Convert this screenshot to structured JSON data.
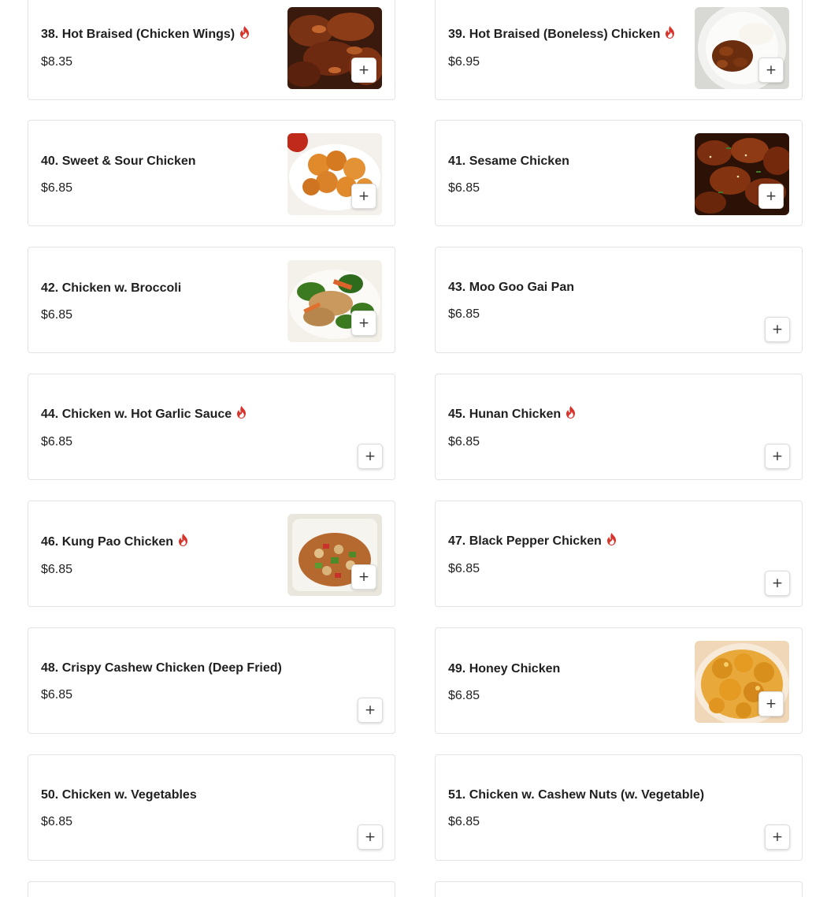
{
  "menu": {
    "items": [
      {
        "label": "38. Hot Braised (Chicken Wings)",
        "price": "$8.35",
        "spicy": true,
        "image": "chicken-wings-photo",
        "add_label": "+"
      },
      {
        "label": "39. Hot Braised (Boneless) Chicken",
        "price": "$6.95",
        "spicy": true,
        "image": "boneless-chicken-rice-photo",
        "add_label": "+"
      },
      {
        "label": "40. Sweet & Sour Chicken",
        "price": "$6.85",
        "spicy": false,
        "image": "sweet-sour-chicken-photo",
        "add_label": "+"
      },
      {
        "label": "41. Sesame Chicken",
        "price": "$6.85",
        "spicy": false,
        "image": "sesame-chicken-photo",
        "add_label": "+"
      },
      {
        "label": "42. Chicken w. Broccoli",
        "price": "$6.85",
        "spicy": false,
        "image": "chicken-broccoli-photo",
        "add_label": "+"
      },
      {
        "label": "43. Moo Goo Gai Pan",
        "price": "$6.85",
        "spicy": false,
        "image": null,
        "add_label": "+"
      },
      {
        "label": "44. Chicken w. Hot Garlic Sauce",
        "price": "$6.85",
        "spicy": true,
        "image": null,
        "add_label": "+"
      },
      {
        "label": "45. Hunan Chicken",
        "price": "$6.85",
        "spicy": true,
        "image": null,
        "add_label": "+"
      },
      {
        "label": "46. Kung Pao Chicken",
        "price": "$6.85",
        "spicy": true,
        "image": "kung-pao-chicken-photo",
        "add_label": "+"
      },
      {
        "label": "47. Black Pepper Chicken",
        "price": "$6.85",
        "spicy": true,
        "image": null,
        "add_label": "+"
      },
      {
        "label": "48. Crispy Cashew Chicken (Deep Fried)",
        "price": "$6.85",
        "spicy": false,
        "image": null,
        "add_label": "+"
      },
      {
        "label": "49. Honey Chicken",
        "price": "$6.85",
        "spicy": false,
        "image": "honey-chicken-photo",
        "add_label": "+"
      },
      {
        "label": "50. Chicken w. Vegetables",
        "price": "$6.85",
        "spicy": false,
        "image": null,
        "add_label": "+"
      },
      {
        "label": "51. Chicken w. Cashew Nuts (w. Vegetable)",
        "price": "$6.85",
        "spicy": false,
        "image": null,
        "add_label": "+"
      }
    ]
  },
  "colors": {
    "spicy_icon": "#d9342b",
    "text": "#1f1f1f",
    "card_border": "#e3e3e3"
  },
  "icons": {
    "spicy": "flame-icon",
    "add": "plus-icon"
  }
}
